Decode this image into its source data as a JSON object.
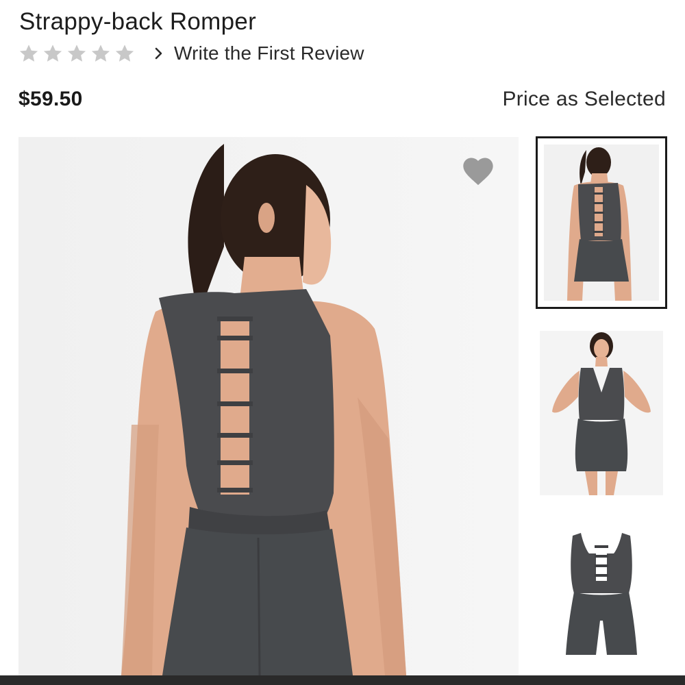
{
  "product": {
    "title": "Strappy-back Romper",
    "price": "$59.50",
    "price_note": "Price as Selected"
  },
  "rating": {
    "stars_filled": 0,
    "stars_total": 5,
    "star_color": "#c8c8c8",
    "review_link": "Write the First Review"
  },
  "icons": {
    "wishlist": "heart-icon",
    "review_chevron": "chevron-right-icon",
    "star": "star-icon"
  },
  "gallery": {
    "selected_index": 0,
    "thumbnails": [
      {
        "view": "back"
      },
      {
        "view": "front"
      },
      {
        "view": "flat"
      }
    ]
  },
  "colors": {
    "garment": "#4a4b4e",
    "heart": "#9a9a9a",
    "selected_border": "#1a1a1a"
  }
}
